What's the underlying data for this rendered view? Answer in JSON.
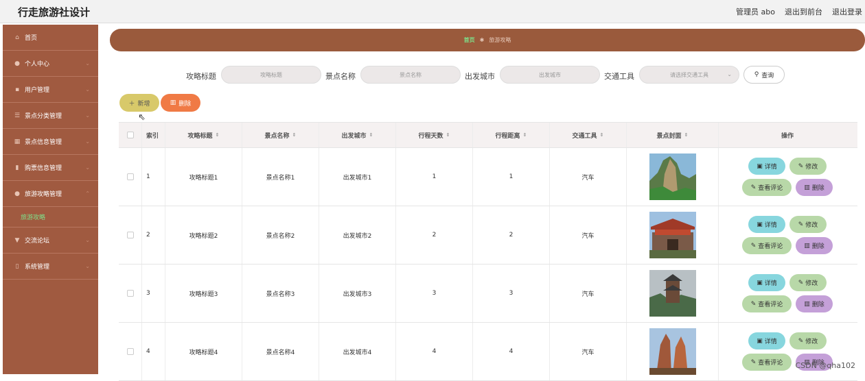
{
  "app": {
    "title": "行走旅游社设计"
  },
  "topbar": {
    "user": "管理员 abo",
    "to_front": "退出到前台",
    "logout": "退出登录"
  },
  "sidebar": {
    "items": [
      {
        "label": "首页"
      },
      {
        "label": "个人中心"
      },
      {
        "label": "用户管理"
      },
      {
        "label": "景点分类管理"
      },
      {
        "label": "景点信息管理"
      },
      {
        "label": "购票信息管理"
      },
      {
        "label": "旅游攻略管理"
      },
      {
        "label": "交流论坛"
      },
      {
        "label": "系统管理"
      }
    ],
    "active_sub": "旅游攻略"
  },
  "breadcrumb": {
    "home": "首页",
    "current": "旅游攻略"
  },
  "search": {
    "label1": "攻略标题",
    "placeholder1": "攻略标题",
    "label2": "景点名称",
    "placeholder2": "景点名称",
    "label3": "出发城市",
    "placeholder3": "出发城市",
    "label4": "交通工具",
    "placeholder4": "请选择交通工具",
    "query": "查询"
  },
  "actions": {
    "add": "新增",
    "delete": "删除"
  },
  "table": {
    "headers": [
      "索引",
      "攻略标题",
      "景点名称",
      "出发城市",
      "行程天数",
      "行程距离",
      "交通工具",
      "景点封面",
      "操作"
    ],
    "rows": [
      {
        "idx": "1",
        "title": "攻略标题1",
        "spot": "景点名称1",
        "city": "出发城市1",
        "days": "1",
        "distance": "1",
        "transport": "汽车"
      },
      {
        "idx": "2",
        "title": "攻略标题2",
        "spot": "景点名称2",
        "city": "出发城市2",
        "days": "2",
        "distance": "2",
        "transport": "汽车"
      },
      {
        "idx": "3",
        "title": "攻略标题3",
        "spot": "景点名称3",
        "city": "出发城市3",
        "days": "3",
        "distance": "3",
        "transport": "汽车"
      },
      {
        "idx": "4",
        "title": "攻略标题4",
        "spot": "景点名称4",
        "city": "出发城市4",
        "days": "4",
        "distance": "4",
        "transport": "汽车"
      }
    ],
    "ops": {
      "detail": "详情",
      "edit": "修改",
      "comment": "查看评论",
      "remove": "删除"
    }
  },
  "watermark": "CSDN @qha102",
  "colors": {
    "sidebar": "#a05a40",
    "breadcrumb": "#9a5a3c",
    "add": "#d8c96a",
    "delete": "#f07a45",
    "active": "#7ee08a"
  }
}
